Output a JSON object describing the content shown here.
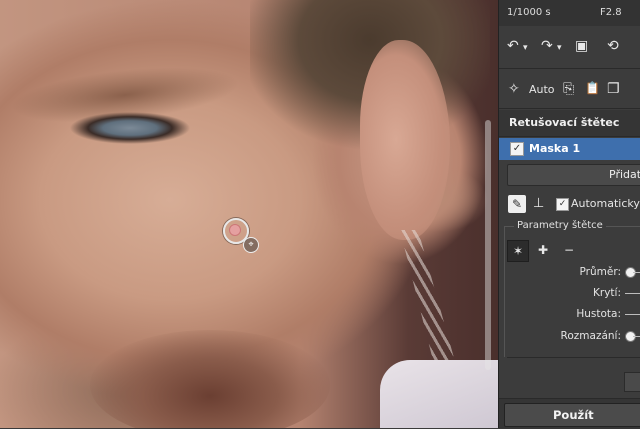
{
  "info": {
    "shutter": "1/1000 s",
    "aperture": "F2.8"
  },
  "toolbar": {
    "undo_icon": "↶",
    "undo_menu_icon": "▾",
    "redo_icon": "↷",
    "redo_menu_icon": "▾",
    "image_icon": "▣",
    "rotate_icon": "⟲",
    "auto_icon": "✧",
    "auto_label": "Auto",
    "copy_icon": "⎘",
    "paste_icon": "📋",
    "duplicate_icon": "❐"
  },
  "panel": {
    "title": "Retušovací štětec",
    "mask": {
      "checked": "✓",
      "label": "Maska 1"
    },
    "add_label": "Přidat",
    "options": {
      "auto_heal_checked": "✓",
      "auto_heal_label": "Automaticky h"
    },
    "params": {
      "title": "Parametry štětce",
      "size_label": "Průměr:",
      "opacity_label": "Krytí:",
      "density_label": "Hustota:",
      "feather_label": "Rozmazání:"
    },
    "apply_label": "Použít"
  }
}
